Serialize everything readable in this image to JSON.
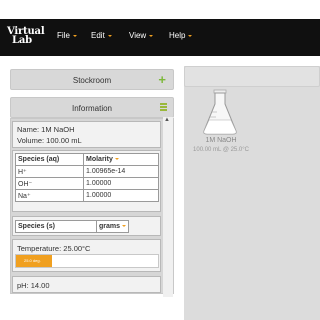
{
  "app": {
    "logo_line1": "Virtual",
    "logo_line2": "Lab"
  },
  "menu": [
    {
      "label": "File"
    },
    {
      "label": "Edit"
    },
    {
      "label": "View"
    },
    {
      "label": "Help"
    }
  ],
  "stockroom": {
    "title": "Stockroom"
  },
  "information": {
    "title": "Information",
    "name": "Name: 1M NaOH",
    "volume": "Volume: 100.00 mL",
    "aq_table": {
      "headers": [
        "Species (aq)",
        "Molarity"
      ],
      "rows": [
        [
          "H⁺",
          "1.00965e-14"
        ],
        [
          "OH⁻",
          "1.00000"
        ],
        [
          "Na⁺",
          "1.00000"
        ]
      ]
    },
    "solid_table": {
      "headers": [
        "Species (s)",
        "grams"
      ]
    },
    "temperature": "Temperature: 25.00°C",
    "temp_bar_label": "25.0 deg.",
    "temp_fraction": 0.25,
    "ph": "pH: 14.00"
  },
  "workbench": {
    "flask_name": "1M NaOH",
    "flask_detail": "100.00 mL @ 25.0°C"
  },
  "colors": {
    "accent": "#f0a020",
    "plus": "#7cb83a",
    "navbar": "#101010"
  }
}
